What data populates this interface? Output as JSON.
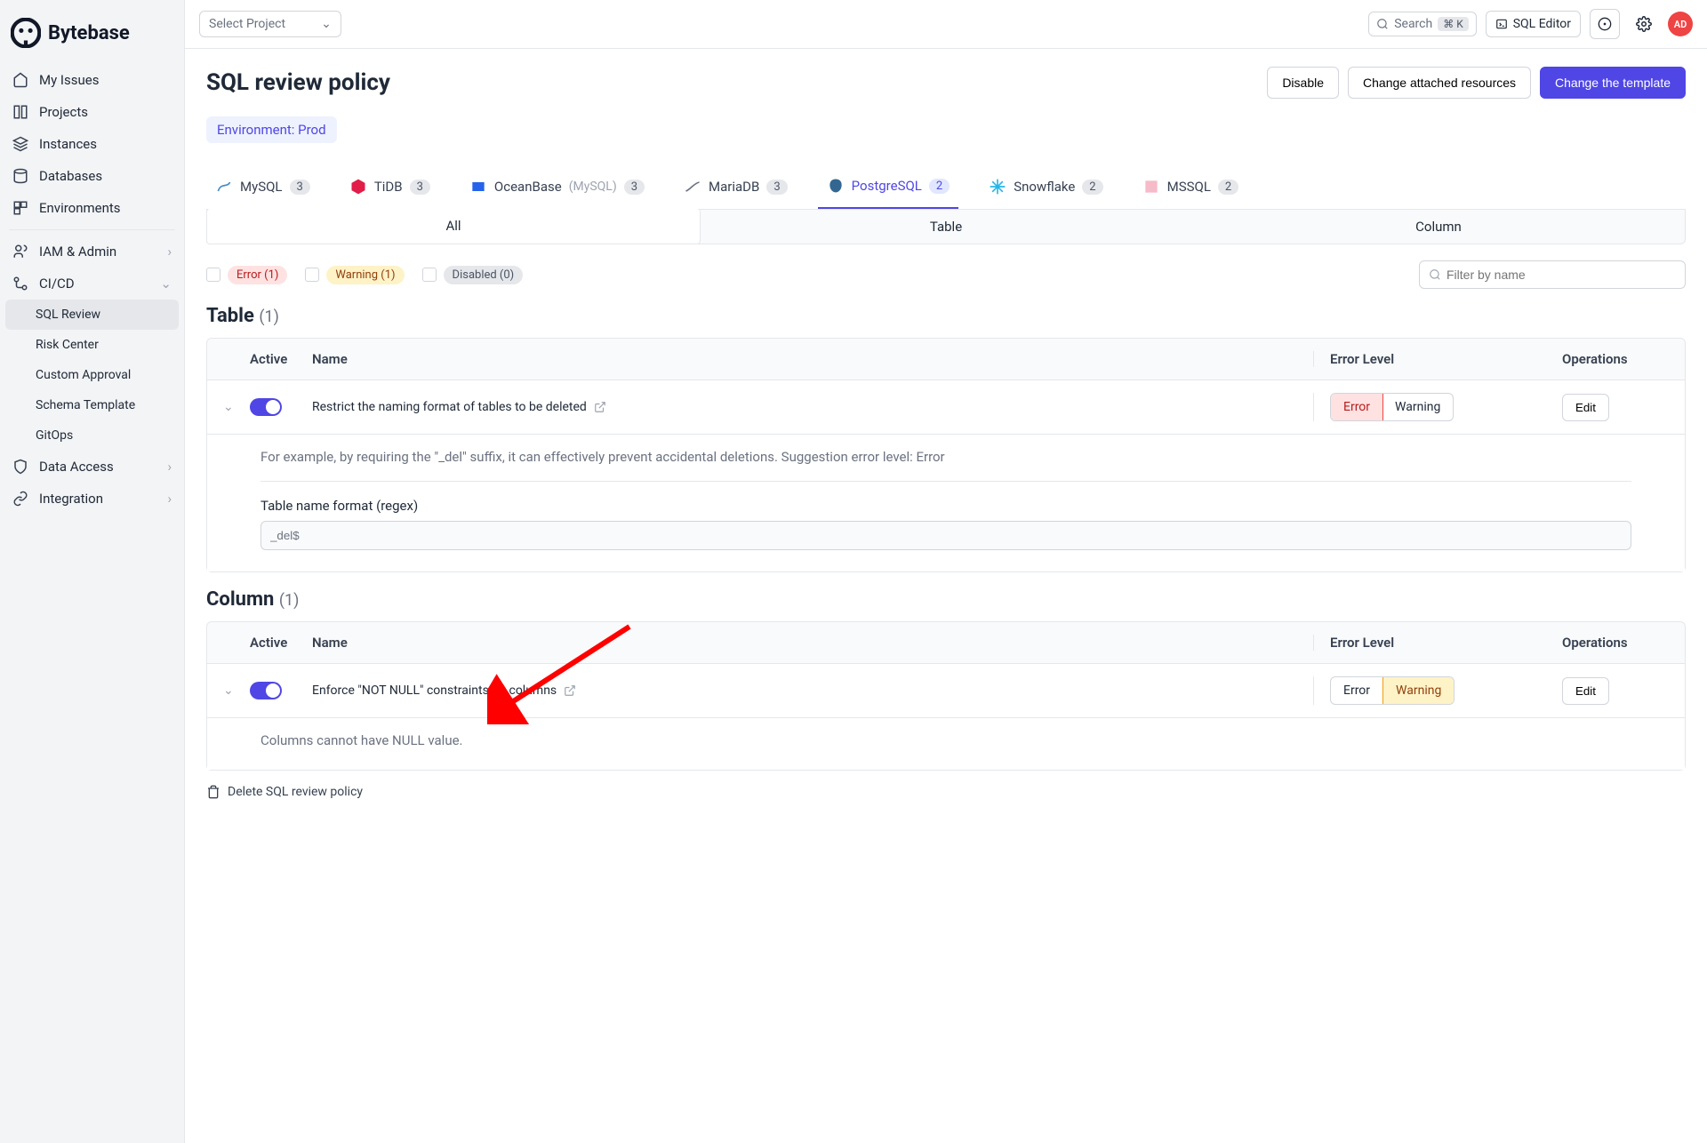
{
  "brand": "Bytebase",
  "topbar": {
    "project_select": "Select Project",
    "search": "Search",
    "search_kbd": "⌘ K",
    "sql_editor": "SQL Editor",
    "avatar": "AD"
  },
  "sidebar": {
    "items": [
      {
        "icon": "home",
        "label": "My Issues"
      },
      {
        "icon": "projects",
        "label": "Projects"
      },
      {
        "icon": "instances",
        "label": "Instances"
      },
      {
        "icon": "databases",
        "label": "Databases"
      },
      {
        "icon": "environments",
        "label": "Environments"
      }
    ],
    "groups": [
      {
        "icon": "users",
        "label": "IAM & Admin",
        "chevron": "›"
      },
      {
        "icon": "cicd",
        "label": "CI/CD",
        "chevron": "⌄",
        "children": [
          {
            "label": "SQL Review",
            "active": true
          },
          {
            "label": "Risk Center"
          },
          {
            "label": "Custom Approval"
          },
          {
            "label": "Schema Template"
          },
          {
            "label": "GitOps"
          }
        ]
      },
      {
        "icon": "shield",
        "label": "Data Access",
        "chevron": "›"
      },
      {
        "icon": "link",
        "label": "Integration",
        "chevron": "›"
      }
    ]
  },
  "page": {
    "title": "SQL review policy",
    "disable": "Disable",
    "change_resources": "Change attached resources",
    "change_template": "Change the template",
    "env_label": "Environment: Prod"
  },
  "db_tabs": [
    {
      "label": "MySQL",
      "count": "3",
      "color": "#4a8bc2"
    },
    {
      "label": "TiDB",
      "count": "3",
      "color": "#e11d48"
    },
    {
      "label": "OceanBase",
      "suffix": "(MySQL)",
      "count": "3",
      "color": "#2563eb"
    },
    {
      "label": "MariaDB",
      "count": "3",
      "color": "#6b7280"
    },
    {
      "label": "PostgreSQL",
      "count": "2",
      "color": "#336791",
      "active": true
    },
    {
      "label": "Snowflake",
      "count": "2",
      "color": "#29b5e8"
    },
    {
      "label": "MSSQL",
      "count": "2",
      "color": "#e11d48"
    }
  ],
  "scope_tabs": [
    "All",
    "Table",
    "Column"
  ],
  "filters": {
    "error": "Error (1)",
    "warning": "Warning (1)",
    "disabled": "Disabled (0)",
    "placeholder": "Filter by name"
  },
  "table_section": {
    "title": "Table",
    "count": "(1)",
    "headers": {
      "active": "Active",
      "name": "Name",
      "level": "Error Level",
      "ops": "Operations"
    },
    "rule_name": "Restrict the naming format of tables to be deleted",
    "level_error": "Error",
    "level_warning": "Warning",
    "edit": "Edit",
    "desc": "For example, by requiring the \"_del\" suffix, it can effectively prevent accidental deletions. Suggestion error level: Error",
    "regex_label": "Table name format (regex)",
    "regex_value": "_del$"
  },
  "column_section": {
    "title": "Column",
    "count": "(1)",
    "headers": {
      "active": "Active",
      "name": "Name",
      "level": "Error Level",
      "ops": "Operations"
    },
    "rule_name": "Enforce \"NOT NULL\" constraints on columns",
    "level_error": "Error",
    "level_warning": "Warning",
    "edit": "Edit",
    "desc": "Columns cannot have NULL value."
  },
  "delete_policy": "Delete SQL review policy"
}
